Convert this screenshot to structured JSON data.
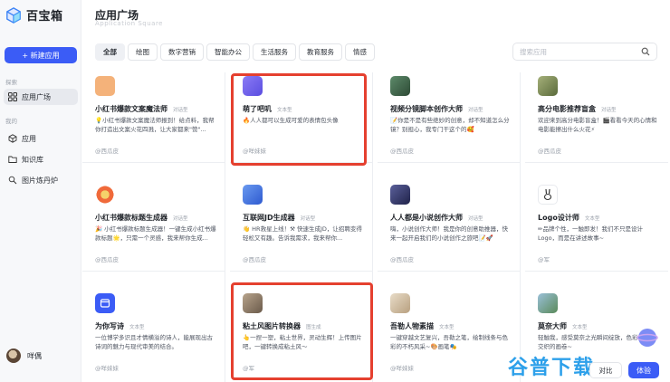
{
  "brand": {
    "name": "百宝箱"
  },
  "sidebar": {
    "new_app": "+ 新建应用",
    "section_explore": "探索",
    "section_mine": "我的",
    "items": [
      {
        "label": "应用广场",
        "icon": "grid-icon"
      },
      {
        "label": "应用",
        "icon": "cube-icon"
      },
      {
        "label": "知识库",
        "icon": "folder-icon"
      },
      {
        "label": "图片炼丹炉",
        "icon": "magic-icon"
      }
    ],
    "user": "咩偶"
  },
  "header": {
    "title": "应用广场",
    "subtitle": "Application Square",
    "search_placeholder": "搜索应用"
  },
  "tabs": [
    "全部",
    "绘图",
    "数字营销",
    "智能办公",
    "生活服务",
    "教育服务",
    "情感"
  ],
  "cards": [
    {
      "title": "小红书爆款文案魔法师",
      "tag": "对话型",
      "desc": "💡小红书爆款文案魔法师报到！给点料，我帮你打造出文案火花四溅，让大家都来\"赞\"...",
      "author": "@西瓜皮",
      "icon_color": "#f4b27a"
    },
    {
      "title": "萌了吧叽",
      "tag": "文本型",
      "desc": "🔥人人都可以生成可爱的表情包头像",
      "author": "@咩妹妹",
      "icon_color": "#7b6cf0"
    },
    {
      "title": "视频分镜脚本创作大师",
      "tag": "对话型",
      "desc": "📝你是不是有些绝妙的创意，却不知道怎么分镜？别担心，我专门干这个的🥰",
      "author": "@西瓜皮",
      "icon_color": "#3d6b4a"
    },
    {
      "title": "高分电影推荐盲盒",
      "tag": "对话型",
      "desc": "欢迎来到高分电影盲盒！🎬看看今天的心情和电影能擦出什么火花⚡",
      "author": "@西瓜皮",
      "icon_color": "#7a8a5a"
    },
    {
      "title": "小红书爆款标题生成器",
      "tag": "对话型",
      "desc": "🎉 小红书爆款标题生成器！一键生成小红书爆款标题🌟，只需一个灵感，我来帮你生成...",
      "author": "@西瓜皮",
      "icon_color": "#f08a4a"
    },
    {
      "title": "互联网JD生成器",
      "tag": "对话型",
      "desc": "👋 HR救星上线！⚒ 快速生成JD，让招聘变得轻松又有趣。告诉我需求，我来帮你...",
      "author": "@西瓜皮",
      "icon_color": "#4a7be0"
    },
    {
      "title": "人人都是小说创作大师",
      "tag": "对话型",
      "desc": "嗨，小说创作大师！我是你的创意助推器，快来一起开启我们的小说创作之旅吧📝🚀",
      "author": "@西瓜皮",
      "icon_color": "#3a3f6b"
    },
    {
      "title": "Logo设计师",
      "tag": "文本型",
      "desc": "✏品牌个性，一触即发！我们不只是设计Logo，而是在讲述故事~",
      "author": "@军",
      "icon_color": "#ffffff"
    },
    {
      "title": "为你写诗",
      "tag": "文本型",
      "desc": "一位博学多识且才情横溢的诗人，能展现出古诗词的魅力与现代审美的结合。",
      "author": "@咩妹妹",
      "icon_color": "#3b5cf6"
    },
    {
      "title": "粘土风图片转换器",
      "tag": "图生成",
      "desc": "👆一捏一塑，粘土世界，灵动生辉！上传图片吧，一键转换成粘土风～",
      "author": "@军",
      "icon_color": "#8a7a6a"
    },
    {
      "title": "吾勒人物素描",
      "tag": "文本型",
      "desc": "一键穿越文艺复兴，吾勒之笔，绘制线条与色彩的不朽风采~🎨画笔🎭",
      "author": "@咩妹妹",
      "icon_color": "#c9b8a0"
    },
    {
      "title": "莫奈大师",
      "tag": "文本型",
      "desc": "轻触我，感受莫奈之光瞬间绽放，色彩与生机交织的画卷~",
      "author": "",
      "icon_color": "#7aa0c0"
    }
  ],
  "buttons": {
    "try": "体验",
    "compare": "对比"
  },
  "watermark": "谷普下载"
}
